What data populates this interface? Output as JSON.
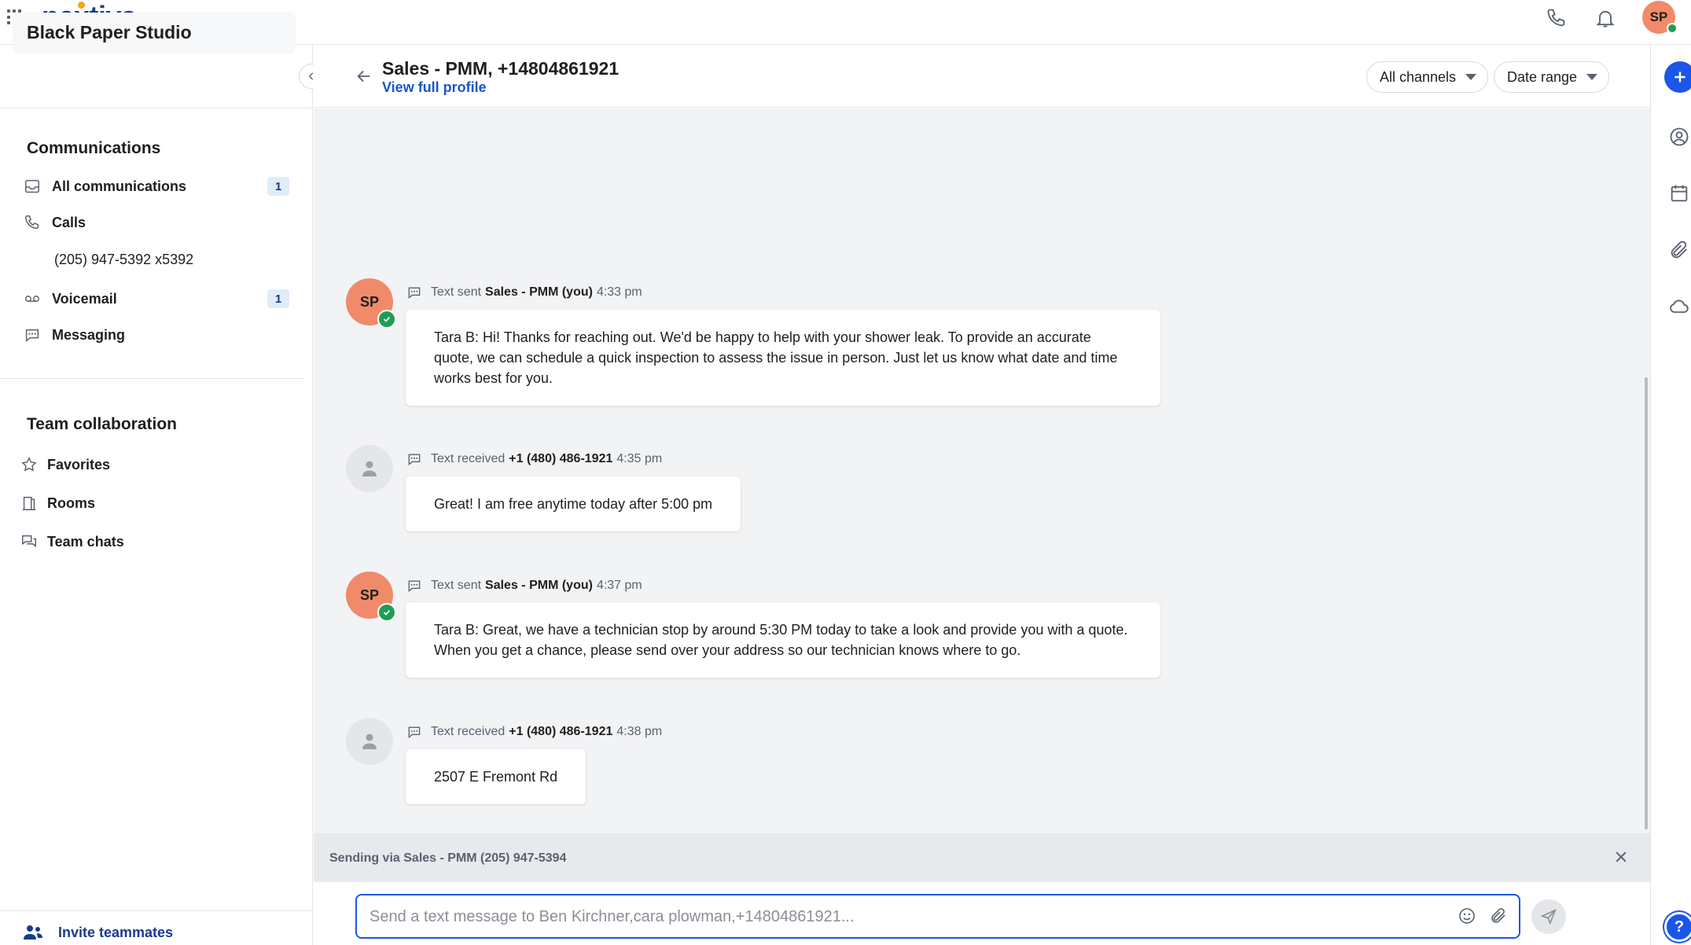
{
  "app": {
    "logo_text": "nextiva",
    "user_initials": "SP"
  },
  "sidebar": {
    "org_name": "Black Paper Studio",
    "communications_title": "Communications",
    "comm_items": [
      {
        "label": "All communications",
        "badge": "1"
      },
      {
        "label": "Calls"
      },
      {
        "label": "Voicemail",
        "badge": "1"
      },
      {
        "label": "Messaging"
      }
    ],
    "calls_sub": "(205) 947-5392 x5392",
    "team_title": "Team collaboration",
    "team_items": [
      {
        "label": "Favorites"
      },
      {
        "label": "Rooms"
      },
      {
        "label": "Team chats"
      }
    ],
    "invite_label": "Invite teammates"
  },
  "header": {
    "title": "Sales - PMM, +14804861921",
    "profile_link": "View full profile",
    "filter_channels": "All channels",
    "filter_date": "Date range"
  },
  "messages": [
    {
      "direction": "sent",
      "initials": "SP",
      "action": "Text sent",
      "who": "Sales - PMM (you)",
      "time": "4:33 pm",
      "text": "Tara B: Hi! Thanks for reaching out. We'd be happy to help with your shower leak. To provide an accurate quote, we can schedule a quick inspection to assess the issue in person. Just let us know what date and time works best for you."
    },
    {
      "direction": "received",
      "action": "Text received",
      "who": "+1 (480) 486-1921",
      "time": "4:35 pm",
      "text": "Great! I am free anytime today after 5:00 pm"
    },
    {
      "direction": "sent",
      "initials": "SP",
      "action": "Text sent",
      "who": "Sales - PMM (you)",
      "time": "4:37 pm",
      "text": "Tara B: Great, we have a technician stop by around 5:30 PM today to take a look and provide you with a quote. When you get a chance, please send over your address so our technician knows where to go."
    },
    {
      "direction": "received",
      "action": "Text received",
      "who": "+1 (480) 486-1921",
      "time": "4:38 pm",
      "text": "2507 E Fremont Rd"
    }
  ],
  "composer": {
    "sending_via": "Sending via Sales - PMM (205) 947-5394",
    "placeholder": "Send a text message to Ben Kirchner,cara plowman,+14804861921..."
  },
  "colors": {
    "brand": "#1a3a8f",
    "accent": "#1a56e8",
    "avatar": "#f08a6a",
    "online": "#1f9d55"
  }
}
